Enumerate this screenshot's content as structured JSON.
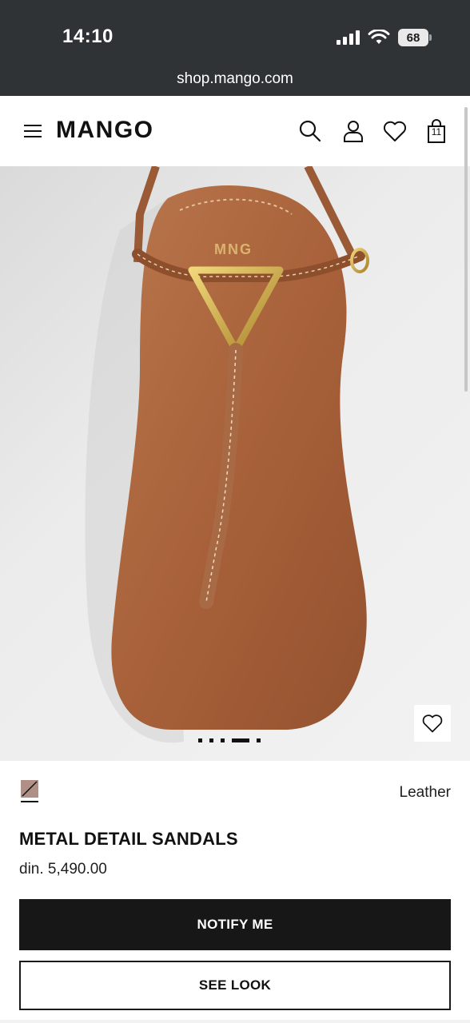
{
  "status_bar": {
    "time": "14:10",
    "battery": "68"
  },
  "browser": {
    "url": "shop.mango.com"
  },
  "header": {
    "logo": "MANGO",
    "bag_count": "11"
  },
  "product": {
    "image_brand_mark": "MNG",
    "color_name": "Leather",
    "swatch_color": "#b08f86",
    "name": "METAL DETAIL SANDALS",
    "price": "din. 5,490.00",
    "gallery_total": 5,
    "gallery_active": 4
  },
  "actions": {
    "notify_label": "NOTIFY ME",
    "see_look_label": "SEE LOOK"
  },
  "colors": {
    "status_bg": "#2f3336",
    "button_dark": "#171717",
    "leather": "#b0683e"
  }
}
